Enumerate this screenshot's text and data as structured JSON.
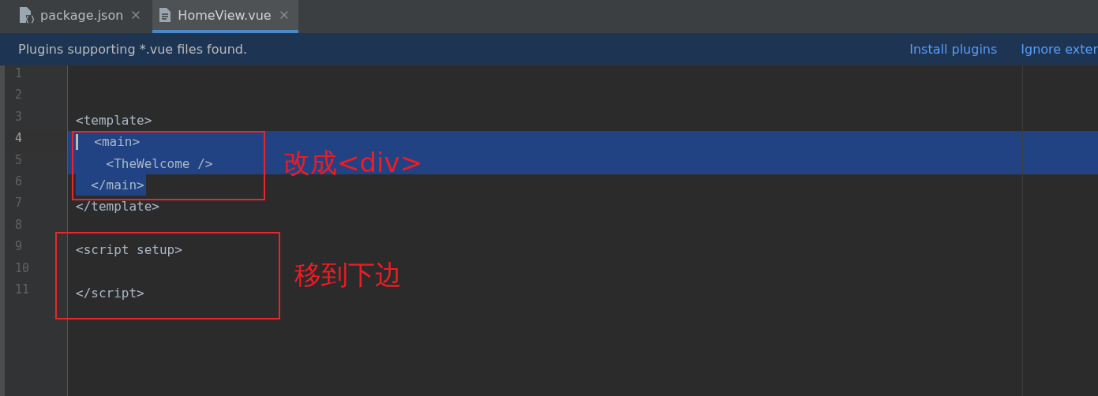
{
  "tabs": [
    {
      "label": "package.json",
      "kind": "json",
      "selected": false
    },
    {
      "label": "HomeView.vue",
      "kind": "file",
      "selected": true
    }
  ],
  "banner": {
    "message": "Plugins supporting *.vue files found.",
    "links": [
      "Install plugins",
      "Ignore exter"
    ]
  },
  "editor": {
    "lines": [
      {
        "number": "1",
        "selected": false,
        "caret": false
      },
      {
        "number": "2",
        "selected": false,
        "caret": false
      },
      {
        "number": "3",
        "code": "<template>",
        "selected": false,
        "caret": false
      },
      {
        "number": "4",
        "code": "  <main>",
        "selected": true,
        "caret": true
      },
      {
        "number": "5",
        "code": "    <TheWelcome />",
        "selected": true,
        "caret": false
      },
      {
        "number": "6",
        "code": "  </main>",
        "selected": true,
        "caret": false
      },
      {
        "number": "7",
        "code": "</template>",
        "selected": false,
        "caret": false
      },
      {
        "number": "8",
        "selected": false,
        "caret": false
      },
      {
        "number": "9",
        "code": "<script setup>",
        "selected": false,
        "caret": false
      },
      {
        "number": "10",
        "selected": false,
        "caret": false
      },
      {
        "number": "11",
        "code": "</script>",
        "selected": false,
        "caret": false
      }
    ]
  },
  "annotations": [
    {
      "text": "改成<div>"
    },
    {
      "text": "移到下边"
    }
  ]
}
